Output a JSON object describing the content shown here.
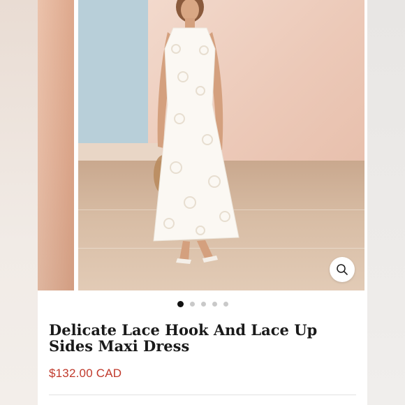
{
  "product": {
    "title_line1": "Delicate Lace Hook And Lace Up",
    "title_line2": "Sides Maxi Dress",
    "price": "$132.00 CAD"
  },
  "carousel": {
    "slide_count": 5,
    "active_index": 0
  },
  "icons": {
    "zoom": "search-icon"
  },
  "colors": {
    "price": "#c0392b",
    "active_dot": "#111111",
    "inactive_dot": "#c9c9c9"
  }
}
